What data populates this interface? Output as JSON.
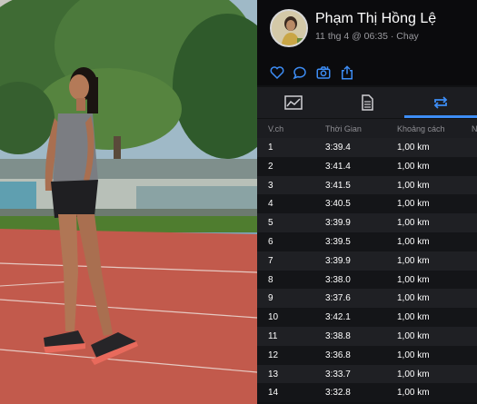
{
  "activity": {
    "athlete_name": "Phạm Thị Hồng Lệ",
    "meta": "11 thg 4 @ 06:35 · Chạy"
  },
  "actions": [
    {
      "icon": "heart-icon"
    },
    {
      "icon": "comment-icon"
    },
    {
      "icon": "camera-icon"
    },
    {
      "icon": "share-icon"
    }
  ],
  "tabs": [
    {
      "icon": "map-chart-icon",
      "active": false
    },
    {
      "icon": "document-icon",
      "active": false
    },
    {
      "icon": "laps-loop-icon",
      "active": true
    }
  ],
  "laps_table": {
    "headers": [
      "V.ch",
      "Thời Gian",
      "Khoảng cách",
      "N"
    ],
    "rows": [
      {
        "lap": "1",
        "time": "3:39.4",
        "distance": "1,00 km"
      },
      {
        "lap": "2",
        "time": "3:41.4",
        "distance": "1,00 km"
      },
      {
        "lap": "3",
        "time": "3:41.5",
        "distance": "1,00 km"
      },
      {
        "lap": "4",
        "time": "3:40.5",
        "distance": "1,00 km"
      },
      {
        "lap": "5",
        "time": "3:39.9",
        "distance": "1,00 km"
      },
      {
        "lap": "6",
        "time": "3:39.5",
        "distance": "1,00 km"
      },
      {
        "lap": "7",
        "time": "3:39.9",
        "distance": "1,00 km"
      },
      {
        "lap": "8",
        "time": "3:38.0",
        "distance": "1,00 km"
      },
      {
        "lap": "9",
        "time": "3:37.6",
        "distance": "1,00 km"
      },
      {
        "lap": "10",
        "time": "3:42.1",
        "distance": "1,00 km"
      },
      {
        "lap": "11",
        "time": "3:38.8",
        "distance": "1,00 km"
      },
      {
        "lap": "12",
        "time": "3:36.8",
        "distance": "1,00 km"
      },
      {
        "lap": "13",
        "time": "3:33.7",
        "distance": "1,00 km"
      },
      {
        "lap": "14",
        "time": "3:32.8",
        "distance": "1,00 km"
      }
    ]
  },
  "colors": {
    "accent": "#3d8df5",
    "track": "#c25a4c",
    "panel_bg": "#111214"
  }
}
